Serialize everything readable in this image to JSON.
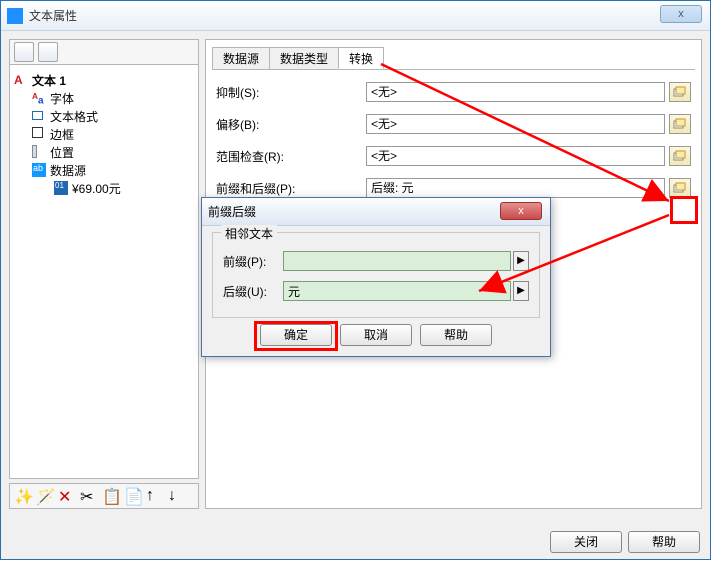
{
  "window": {
    "title": "文本属性",
    "close_glyph": "x"
  },
  "tree": {
    "root": "文本 1",
    "font": "字体",
    "format": "文本格式",
    "border": "边框",
    "position": "位置",
    "datasource": "数据源",
    "value": "¥69.00元"
  },
  "tabs": {
    "datasource": "数据源",
    "datatype": "数据类型",
    "convert": "转换"
  },
  "form": {
    "suppress_label": "抑制(S):",
    "suppress_value": "<无>",
    "offset_label": "偏移(B):",
    "offset_value": "<无>",
    "range_label": "范围检查(R):",
    "range_value": "<无>",
    "prefixsuffix_label": "前缀和后缀(P):",
    "prefixsuffix_value": "后缀: 元"
  },
  "buttons": {
    "close": "关闭",
    "help": "帮助"
  },
  "dialog": {
    "title": "前缀后缀",
    "close_glyph": "x",
    "legend": "相邻文本",
    "prefix_label": "前缀(P):",
    "prefix_value": "",
    "suffix_label": "后缀(U):",
    "suffix_value": "元",
    "ok": "确定",
    "cancel": "取消",
    "help": "帮助"
  }
}
